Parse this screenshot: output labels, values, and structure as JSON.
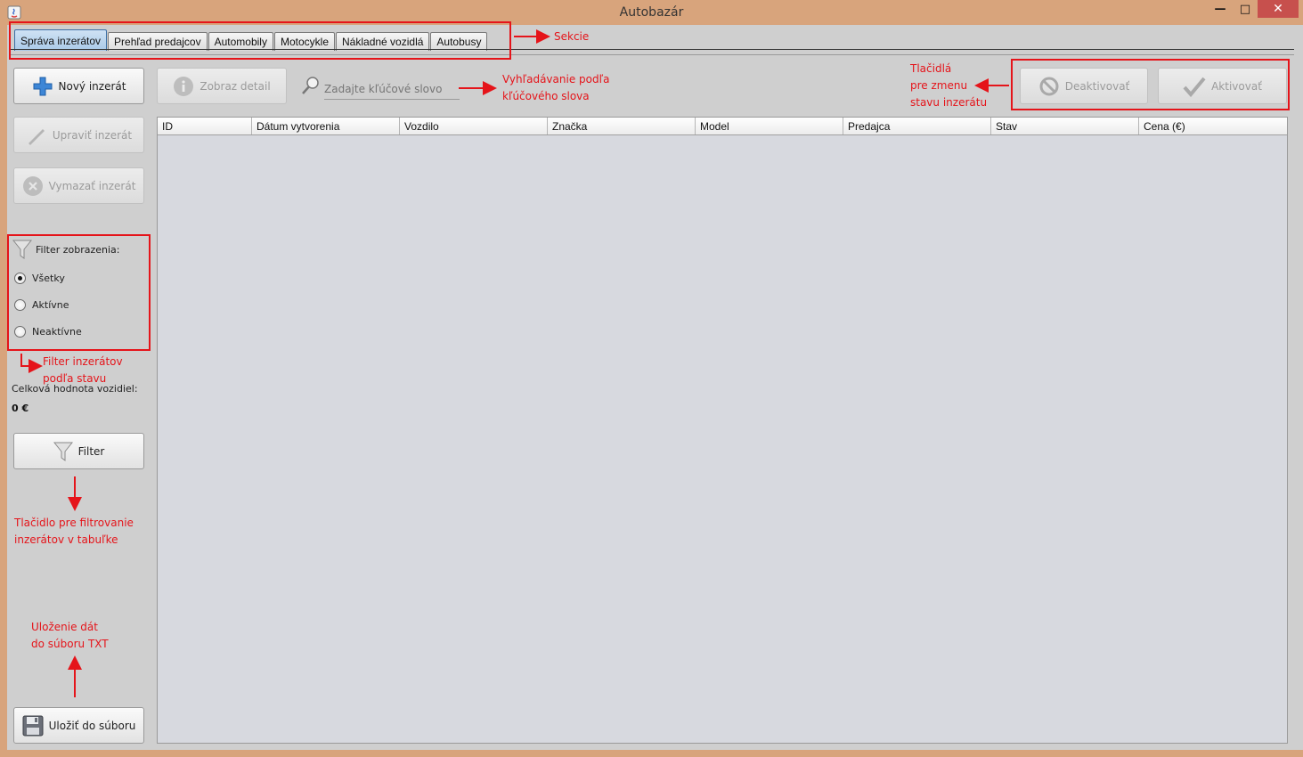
{
  "window": {
    "title": "Autobazár",
    "controls": [
      "—",
      "□",
      "✕"
    ]
  },
  "tabs": [
    {
      "label": "Správa inzerátov",
      "active": true
    },
    {
      "label": "Prehľad predajcov",
      "active": false
    },
    {
      "label": "Automobily",
      "active": false
    },
    {
      "label": "Motocykle",
      "active": false
    },
    {
      "label": "Nákladné vozidlá",
      "active": false
    },
    {
      "label": "Autobusy",
      "active": false
    }
  ],
  "toolbar": {
    "new_label": "Nový inzerát",
    "edit_label": "Upraviť inzerát",
    "delete_label": "Vymazať inzerát",
    "detail_label": "Zobraz detail",
    "search_placeholder": "Zadajte kľúčové slovo",
    "deactivate_label": "Deaktivovať",
    "activate_label": "Aktivovať"
  },
  "filter": {
    "heading": "Filter zobrazenia:",
    "options": [
      {
        "label": "Všetky",
        "checked": true
      },
      {
        "label": "Aktívne",
        "checked": false
      },
      {
        "label": "Neaktívne",
        "checked": false
      }
    ],
    "total_label": "Celková hodnota vozidiel:",
    "total_value": "0 €",
    "filter_button": "Filter",
    "save_button": "Uložiť do súboru"
  },
  "table": {
    "columns": [
      "ID",
      "Dátum vytvorenia",
      "Vozdilo",
      "Značka",
      "Model",
      "Predajca",
      "Stav",
      "Cena (€)"
    ],
    "rows": []
  },
  "annotations": {
    "sections": "Sekcie",
    "search_1": "Vyhľadávanie podľa",
    "search_2": "kľúčového slova",
    "status_1": "Tlačidlá",
    "status_2": "pre zmenu",
    "status_3": "stavu inzerátu",
    "filter_1": "Filter inzerátov",
    "filter_2": "podľa stavu",
    "filterbtn_1": "Tlačidlo pre filtrovanie",
    "filterbtn_2": "inzerátov v tabuľke",
    "save_1": "Uloženie dát",
    "save_2": "do súboru TXT"
  },
  "colors": {
    "window_frame": "#d8a47c",
    "client": "#cfcfcf",
    "table_bg": "#d7d9df",
    "annotation": "#e5141a",
    "active_tab": "#a9c9e8",
    "close_button": "#c7504d"
  }
}
